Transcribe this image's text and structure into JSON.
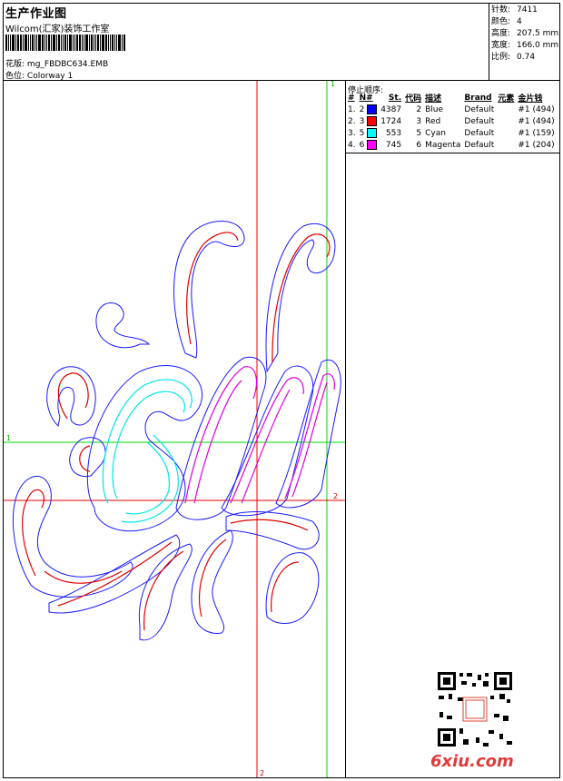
{
  "header": {
    "title": "生产作业图",
    "studio": "Wilcom(汇家)装饰工作室",
    "pattern_label": "花版:",
    "pattern_value": "mg_FBDBC634.EMB",
    "colorway_label": "色位:",
    "colorway_value": "Colorway 1"
  },
  "info": {
    "stitches_label": "针数:",
    "stitches_value": "7411",
    "colors_label": "颜色:",
    "colors_value": "4",
    "height_label": "高度:",
    "height_value": "207.5 mm",
    "width_label": "宽度:",
    "width_value": "166.0 mm",
    "scale_label": "比例:",
    "scale_value": "0.74"
  },
  "stop_sequence": {
    "title": "停止顺序:",
    "headers": {
      "hash": "#",
      "n": "N#",
      "st": "St.",
      "code": "代码",
      "desc": "描述",
      "brand": "Brand",
      "element": "元素",
      "sequin": "金片钱"
    },
    "rows": [
      {
        "idx": "1.",
        "n": "2",
        "color": "#0000ff",
        "st": "4387",
        "code": "2",
        "desc": "Blue",
        "brand": "Default",
        "element": "",
        "sequin": "#1 (494)"
      },
      {
        "idx": "2.",
        "n": "3",
        "color": "#ff0000",
        "st": "1724",
        "code": "3",
        "desc": "Red",
        "brand": "Default",
        "element": "",
        "sequin": "#1 (494)"
      },
      {
        "idx": "3.",
        "n": "5",
        "color": "#00ffff",
        "st": "553",
        "code": "5",
        "desc": "Cyan",
        "brand": "Default",
        "element": "",
        "sequin": "#1 (159)"
      },
      {
        "idx": "4.",
        "n": "6",
        "color": "#ff00ff",
        "st": "745",
        "code": "6",
        "desc": "Magenta",
        "brand": "Default",
        "element": "",
        "sequin": "#1 (204)"
      }
    ]
  },
  "guides": {
    "green_top": "1",
    "green_left": "1",
    "red_right": "2",
    "red_bottom": "2"
  },
  "colors": {
    "blue": "#1a1aff",
    "red": "#e00000",
    "cyan": "#00e5e5",
    "magenta": "#e000e0",
    "guide_green": "#00dd00",
    "guide_red": "#ee0000"
  },
  "watermark": {
    "logo_text": "6xiu.com"
  }
}
